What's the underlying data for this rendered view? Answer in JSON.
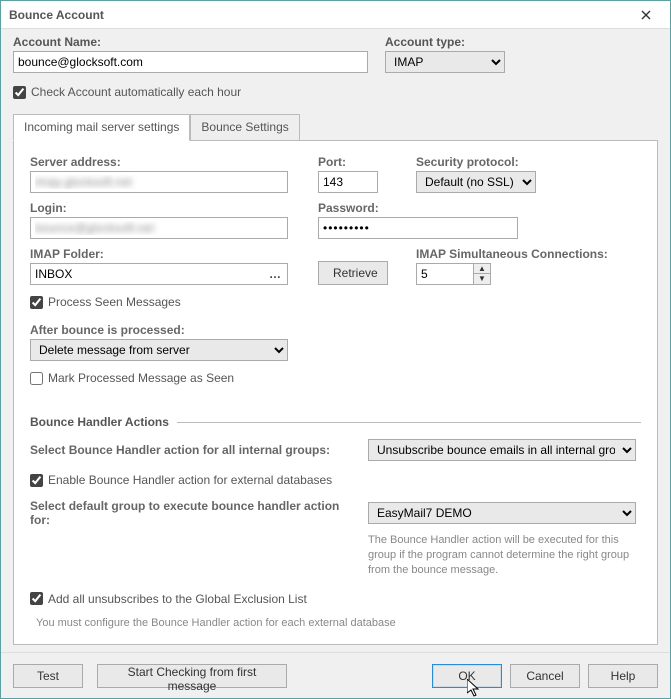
{
  "window": {
    "title": "Bounce Account"
  },
  "top": {
    "account_name_label": "Account Name:",
    "account_name_value": "bounce@glocksoft.com",
    "account_type_label": "Account type:",
    "account_type_value": "IMAP",
    "auto_check_label": "Check Account automatically each hour",
    "auto_check_checked": true
  },
  "tabs": {
    "incoming": "Incoming mail server settings",
    "bounce": "Bounce Settings",
    "active": "incoming"
  },
  "incoming": {
    "server_label": "Server address:",
    "server_value": "imap.glocksoft.net",
    "port_label": "Port:",
    "port_value": "143",
    "security_label": "Security protocol:",
    "security_value": "Default (no SSL)",
    "login_label": "Login:",
    "login_value": "bounce@glocksoft.net",
    "password_label": "Password:",
    "password_value": "•••••••••",
    "imap_folder_label": "IMAP Folder:",
    "imap_folder_value": "INBOX",
    "retrieve_label": "Retrieve",
    "imap_conn_label": "IMAP Simultaneous Connections:",
    "imap_conn_value": "5",
    "process_seen_label": "Process Seen Messages",
    "process_seen_checked": true,
    "after_bounce_label": "After bounce is processed:",
    "after_bounce_value": "Delete message from server",
    "mark_processed_label": "Mark Processed Message as Seen",
    "mark_processed_checked": false,
    "section_title": "Bounce Handler Actions",
    "internal_action_label": "Select Bounce Handler action for all internal groups:",
    "internal_action_value": "Unsubscribe bounce emails in all internal groups",
    "enable_external_label": "Enable Bounce Handler action for external databases",
    "enable_external_checked": true,
    "default_group_label": "Select default group to execute bounce handler action for:",
    "default_group_value": "EasyMail7 DEMO",
    "default_group_note": "The Bounce Handler action will be executed for this group if the program cannot determine the right group from the bounce message.",
    "global_exclusion_label": "Add all unsubscribes to the Global Exclusion List",
    "global_exclusion_checked": true,
    "footer_note": "You must configure the Bounce Handler action for each external database"
  },
  "buttons": {
    "test": "Test",
    "start_first": "Start Checking from first message",
    "ok": "OK",
    "cancel": "Cancel",
    "help": "Help"
  }
}
